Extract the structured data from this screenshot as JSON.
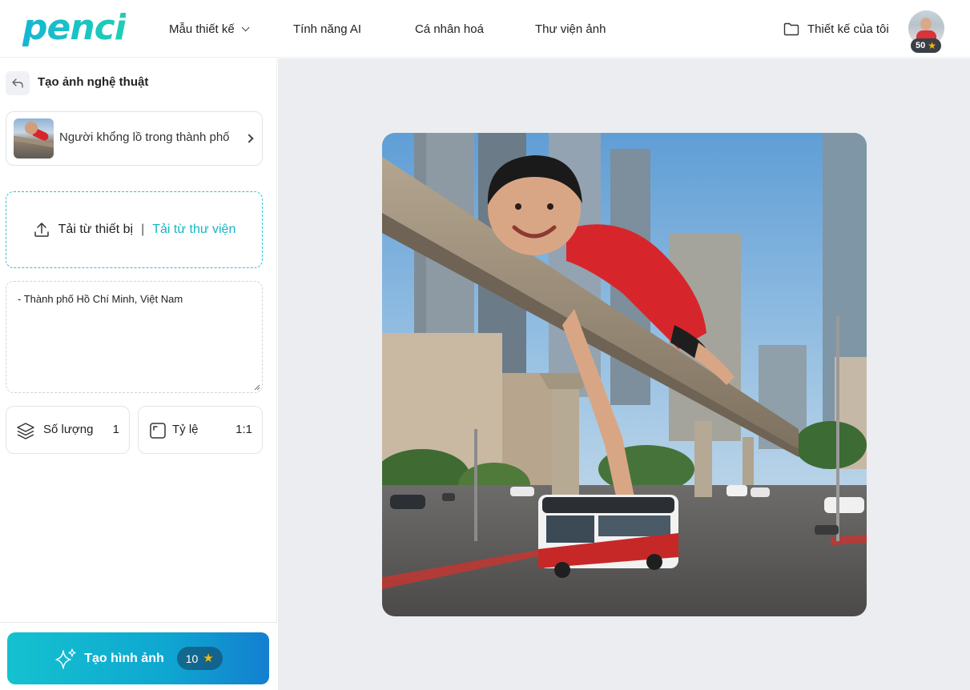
{
  "app": {
    "logo": "penci"
  },
  "header": {
    "nav": [
      {
        "label": "Mẫu thiết kế",
        "has_dropdown": true
      },
      {
        "label": "Tính năng AI"
      },
      {
        "label": "Cá nhân hoá"
      },
      {
        "label": "Thư viện ảnh"
      }
    ],
    "my_designs_label": "Thiết kế của tôi",
    "credits": "50"
  },
  "sidebar": {
    "title": "Tạo ảnh nghệ thuật",
    "template_name": "Người khổng lồ trong thành phố",
    "upload": {
      "device_label": "Tải từ thiết bị",
      "separator": "|",
      "library_label": "Tải từ thư viện"
    },
    "prompt_text": "- Thành phố Hồ Chí Minh, Việt Nam",
    "quantity": {
      "label": "Số lượng",
      "value": "1"
    },
    "ratio": {
      "label": "Tỷ lệ",
      "value": "1:1"
    },
    "generate": {
      "label": "Tạo hình ảnh",
      "cost": "10"
    }
  },
  "colors": {
    "accent": "#17b3c4",
    "button_gradient_start": "#14c2cf",
    "button_gradient_end": "#137fd0",
    "canvas_bg": "#ebedf0"
  },
  "icons": {
    "star": "★"
  }
}
